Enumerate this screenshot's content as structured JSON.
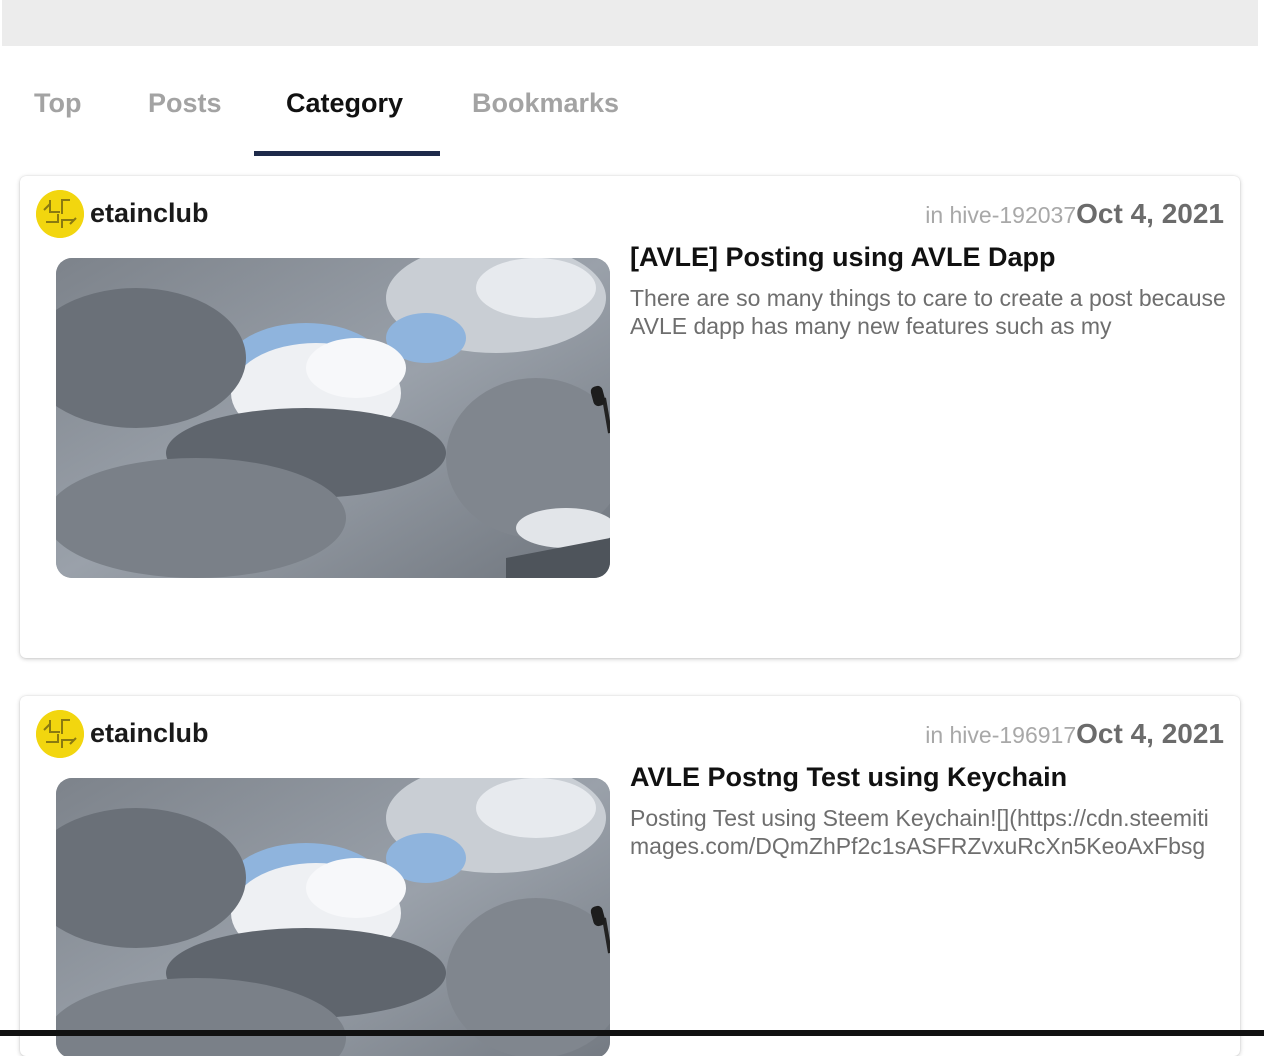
{
  "tabs": [
    {
      "label": "Top",
      "active": false
    },
    {
      "label": "Posts",
      "active": false
    },
    {
      "label": "Category",
      "active": true
    },
    {
      "label": "Bookmarks",
      "active": false
    }
  ],
  "posts": [
    {
      "author": "etainclub",
      "community": "in hive-192037",
      "date": "Oct 4, 2021",
      "title": "[AVLE] Posting using AVLE Dapp",
      "excerpt": "There are so many things to care to create a post because AVLE dapp has many new features such as my"
    },
    {
      "author": "etainclub",
      "community": "in hive-196917",
      "date": "Oct 4, 2021",
      "title": "AVLE Postng Test using Keychain",
      "excerpt": "Posting Test using Steem Keychain![](https://cdn.steemitimages.com/DQmZhPf2c1sASFRZvxuRcXn5KeoAxFbsg"
    }
  ],
  "colors": {
    "tab_indicator": "#1e2a4a",
    "avatar_bg": "#f2d60f",
    "inactive_tab": "#a3a3a3"
  }
}
